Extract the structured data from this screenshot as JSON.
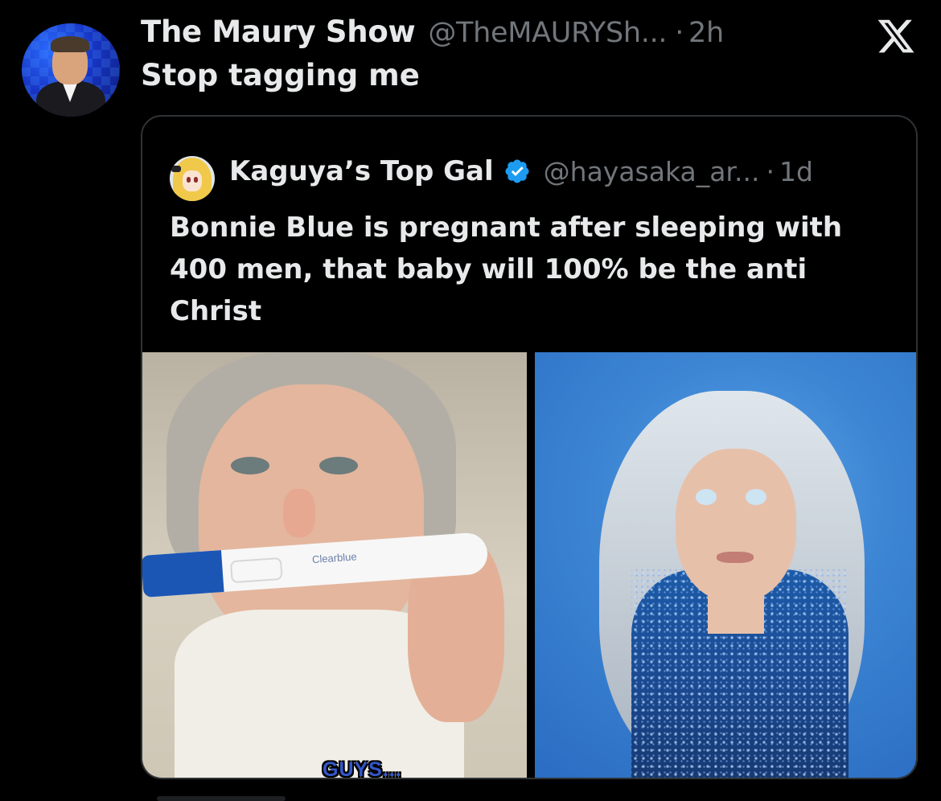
{
  "tweet": {
    "display_name": "The Maury Show",
    "handle": "@TheMAURYSh...",
    "separator": "·",
    "time": "2h",
    "text": "Stop tagging me",
    "avatar_icon": "profile-photo-avatar",
    "logo_icon": "x-logo-icon"
  },
  "quoted_tweet": {
    "display_name": "Kaguya’s Top Gal",
    "verified": true,
    "verified_color": "#1d9bf0",
    "handle": "@hayasaka_ar...",
    "separator": "·",
    "time": "1d",
    "text": "Bonnie Blue is pregnant after sleeping with 400 men, that baby will 100% be the anti Christ",
    "media": {
      "left_image_caption": "GUYS...",
      "left_image_test_brand": "Clearblue"
    }
  },
  "colors": {
    "background": "#000000",
    "text_primary": "#e7e9ea",
    "text_secondary": "#71767b",
    "border": "#2f3336",
    "verified_blue": "#1d9bf0",
    "caption_blue": "#3457c9"
  }
}
